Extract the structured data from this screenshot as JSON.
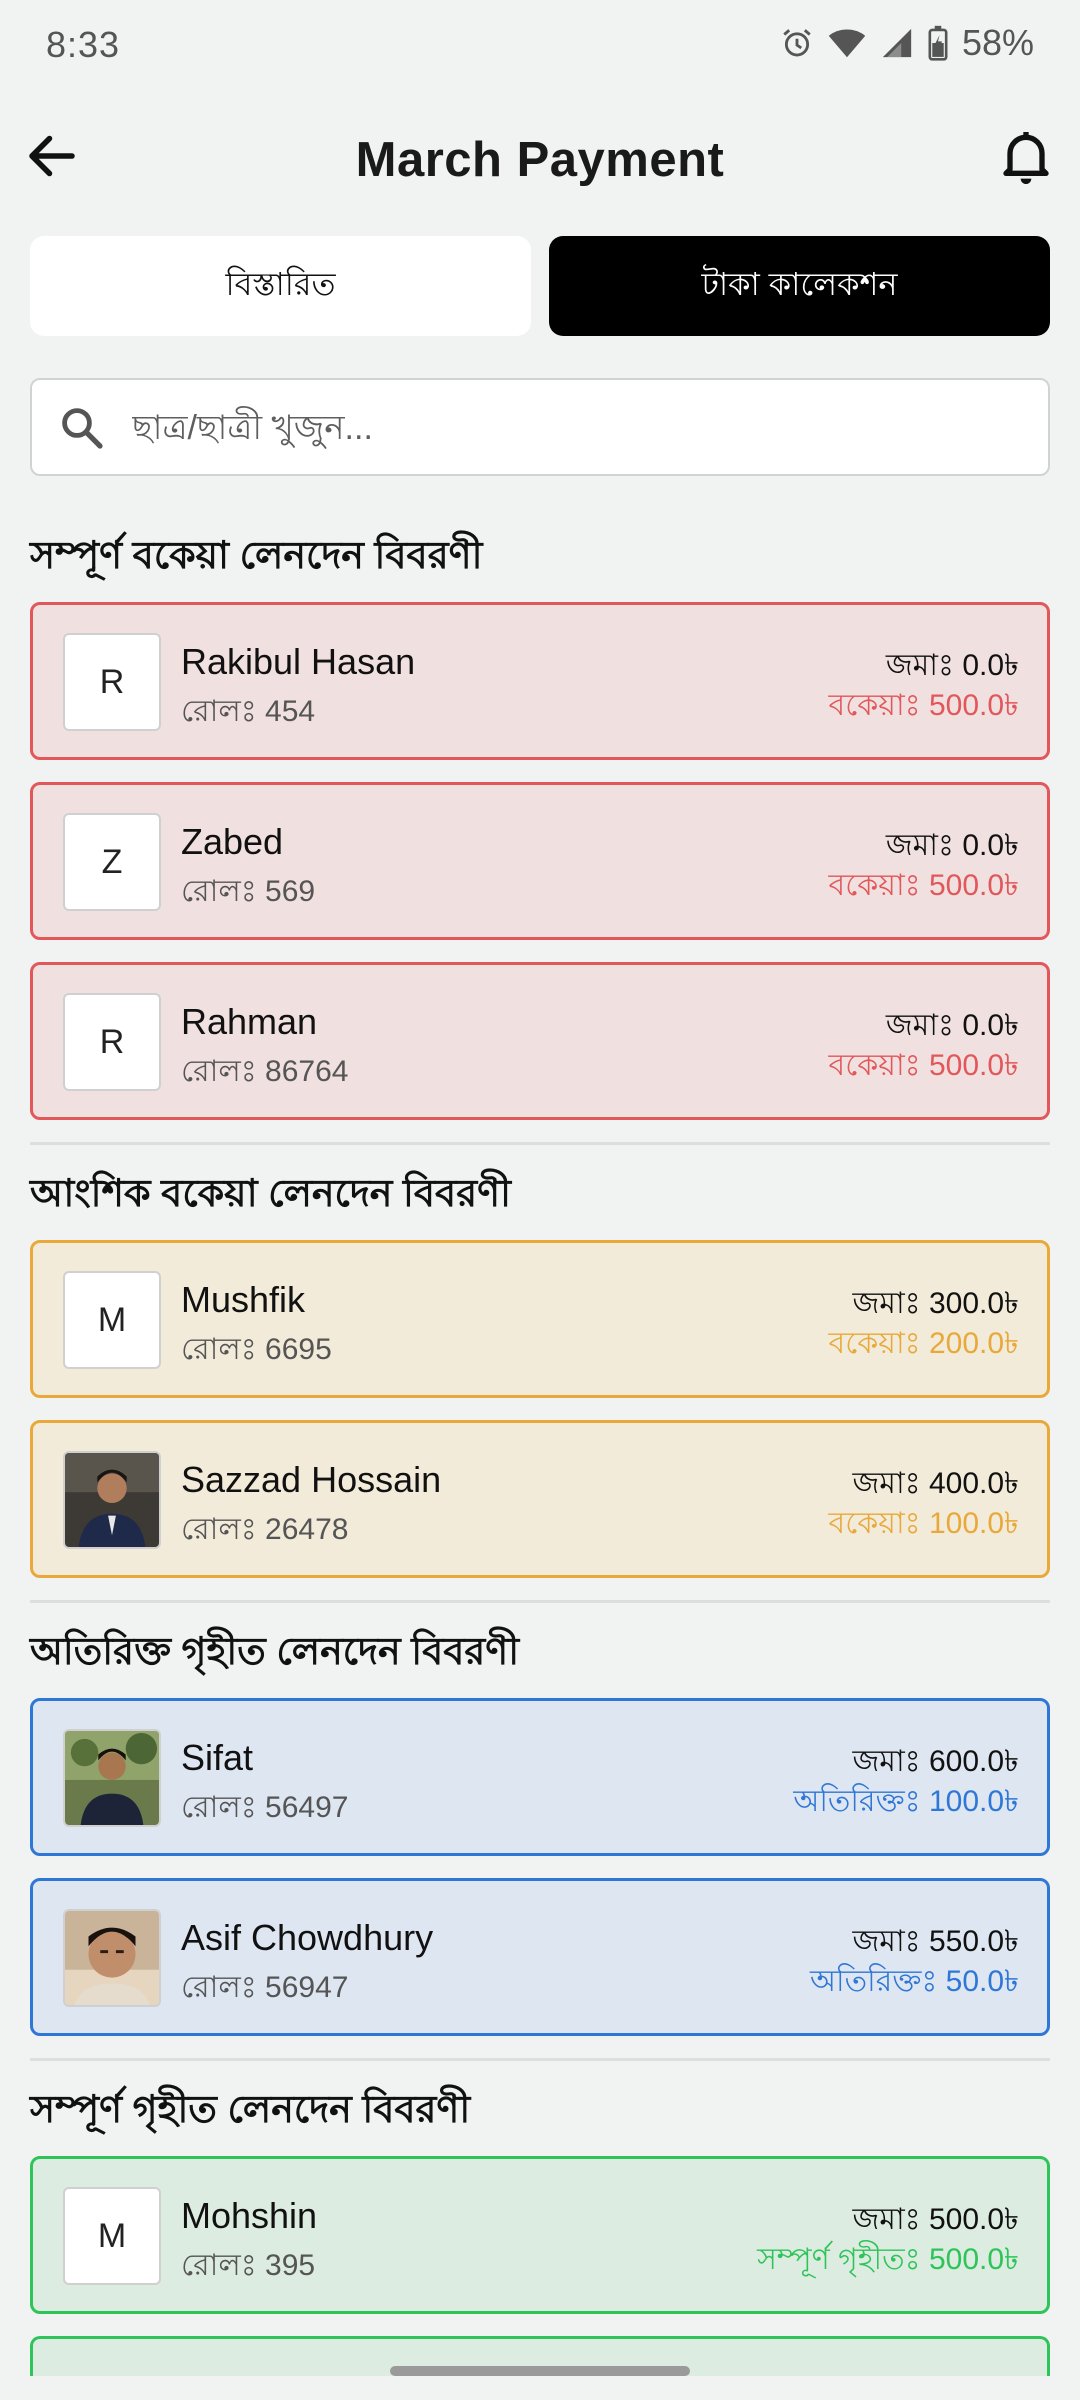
{
  "status": {
    "time": "8:33",
    "battery": "58%"
  },
  "header": {
    "title": "March Payment"
  },
  "tabs": [
    {
      "label": "বিস্তারিত"
    },
    {
      "label": "টাকা কালেকশন"
    }
  ],
  "search": {
    "placeholder": "ছাত্র/ছাত্রী খুজুন..."
  },
  "sections": {
    "due": {
      "title": "সম্পূর্ণ বকেয়া লেনদেন বিবরণী",
      "items": [
        {
          "initial": "R",
          "name": "Rakibul Hasan",
          "roll": "রোলঃ 454",
          "deposit": "জমাঃ 0.0৳",
          "balance": "বকেয়াঃ 500.0৳"
        },
        {
          "initial": "Z",
          "name": "Zabed",
          "roll": "রোলঃ 569",
          "deposit": "জমাঃ 0.0৳",
          "balance": "বকেয়াঃ 500.0৳"
        },
        {
          "initial": "R",
          "name": "Rahman",
          "roll": "রোলঃ 86764",
          "deposit": "জমাঃ 0.0৳",
          "balance": "বকেয়াঃ 500.0৳"
        }
      ]
    },
    "partial": {
      "title": "আংশিক বকেয়া লেনদেন বিবরণী",
      "items": [
        {
          "initial": "M",
          "name": "Mushfik",
          "roll": "রোলঃ 6695",
          "deposit": "জমাঃ 300.0৳",
          "balance": "বকেয়াঃ 200.0৳"
        },
        {
          "initial": "",
          "name": "Sazzad Hossain",
          "roll": "রোলঃ 26478",
          "deposit": "জমাঃ 400.0৳",
          "balance": "বকেয়াঃ 100.0৳"
        }
      ]
    },
    "extra": {
      "title": "অতিরিক্ত গৃহীত লেনদেন বিবরণী",
      "items": [
        {
          "initial": "",
          "name": "Sifat",
          "roll": "রোলঃ 56497",
          "deposit": "জমাঃ 600.0৳",
          "balance": "অতিরিক্তঃ 100.0৳"
        },
        {
          "initial": "",
          "name": "Asif Chowdhury",
          "roll": "রোলঃ 56947",
          "deposit": "জমাঃ 550.0৳",
          "balance": "অতিরিক্তঃ 50.0৳"
        }
      ]
    },
    "full": {
      "title": "সম্পূর্ণ গৃহীত লেনদেন বিবরণী",
      "items": [
        {
          "initial": "M",
          "name": "Mohshin",
          "roll": "রোলঃ 395",
          "deposit": "জমাঃ 500.0৳",
          "balance": "সম্পূর্ণ গৃহীতঃ 500.0৳"
        }
      ]
    }
  },
  "colors": {
    "due": "#e2575a",
    "partial": "#e8a93a",
    "extra": "#2f77d6",
    "full": "#2fc459"
  }
}
